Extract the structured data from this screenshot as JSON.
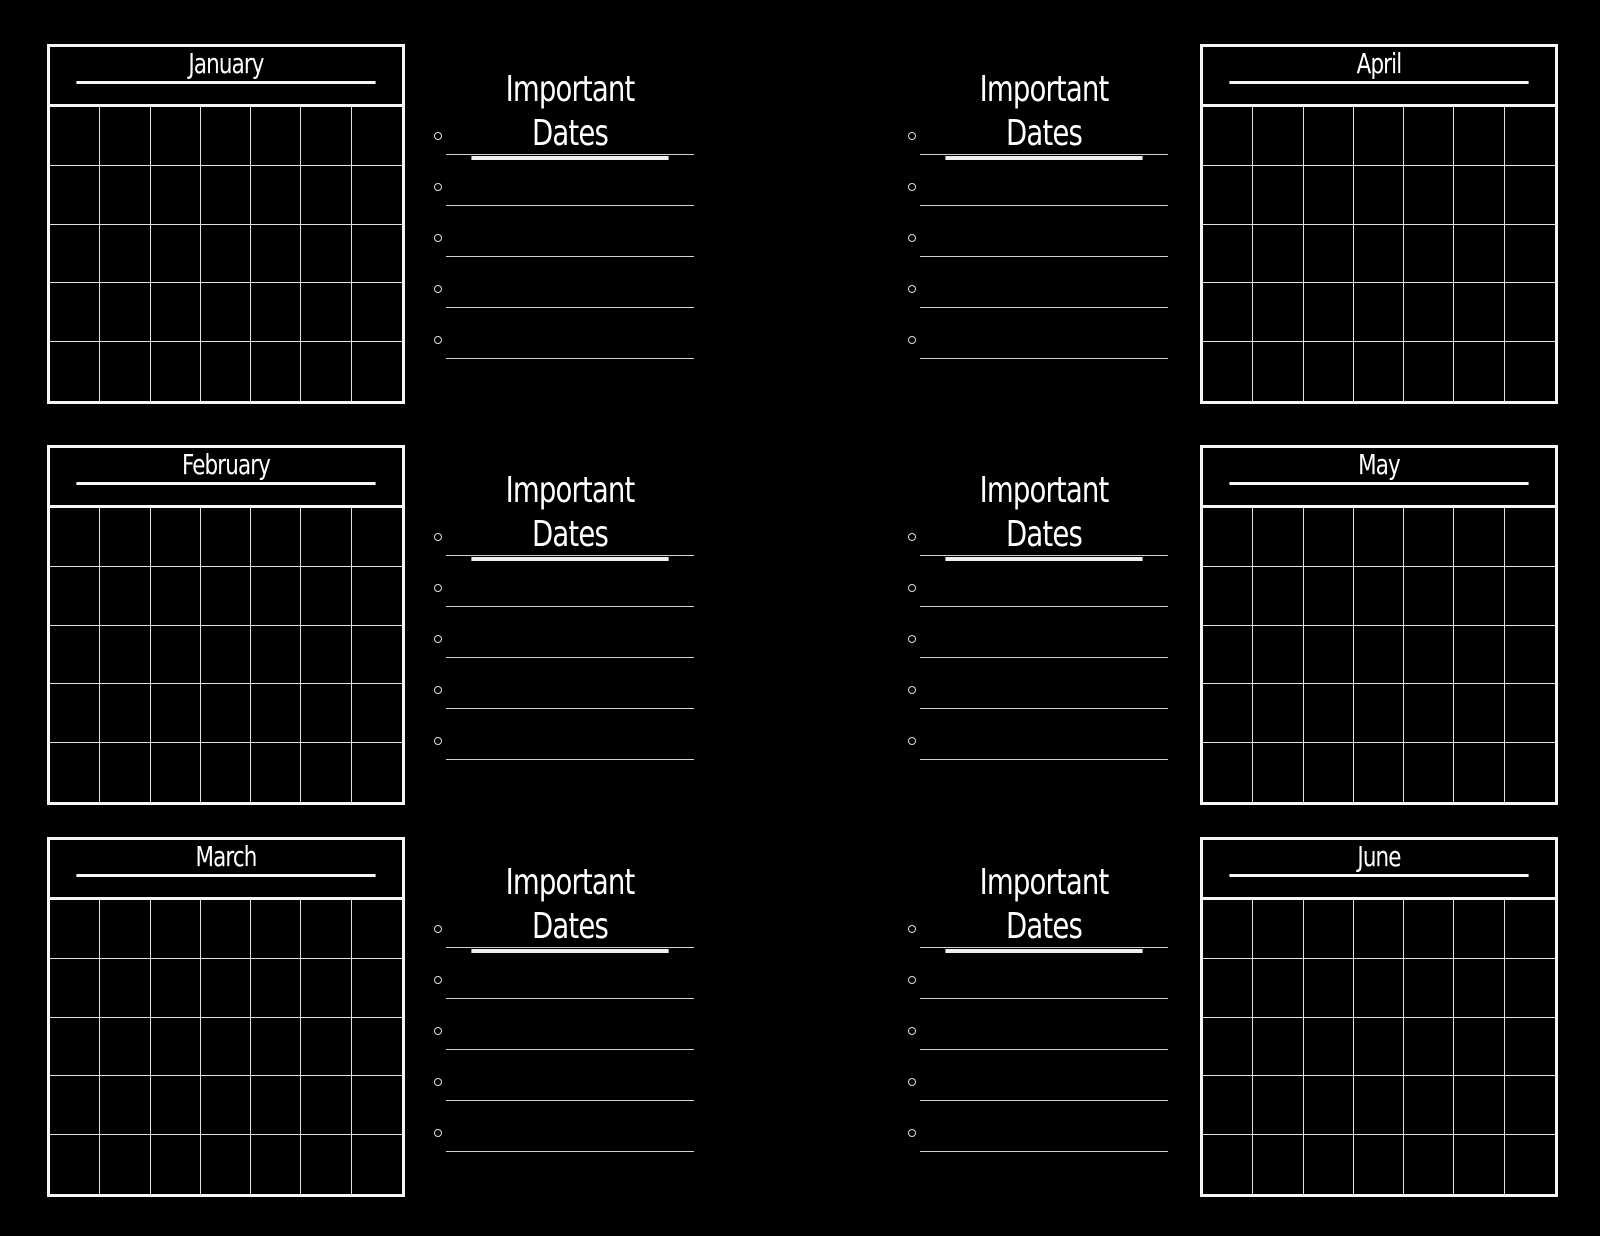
{
  "months": [
    {
      "name": "January",
      "column": "left"
    },
    {
      "name": "February",
      "column": "left"
    },
    {
      "name": "March",
      "column": "left"
    },
    {
      "name": "April",
      "column": "right"
    },
    {
      "name": "May",
      "column": "right"
    },
    {
      "name": "June",
      "column": "right"
    }
  ],
  "calendar_grid": {
    "columns": 7,
    "rows": 5
  },
  "important_dates": {
    "title": "Important Dates",
    "entries_per_month": 5
  },
  "colors": {
    "background": "#000000",
    "lines": "#f4f7f5"
  }
}
